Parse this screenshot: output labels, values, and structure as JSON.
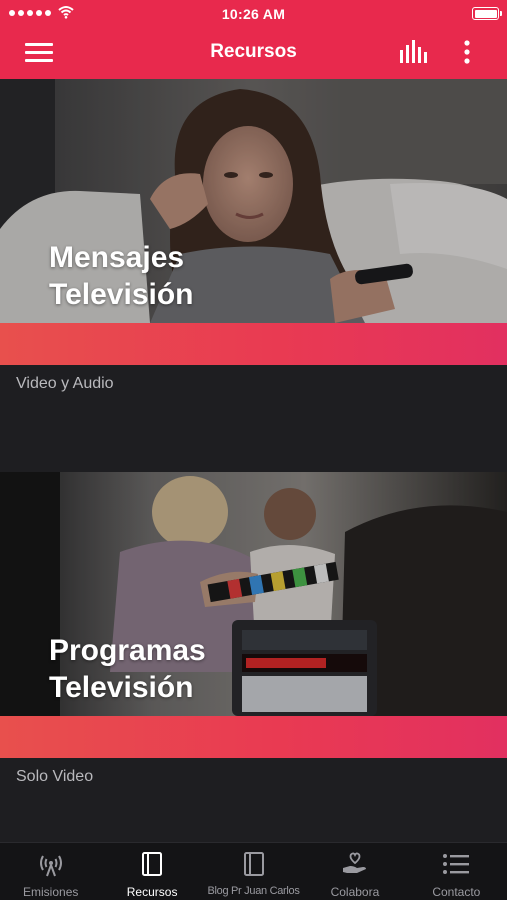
{
  "status_bar": {
    "time": "10:26 AM"
  },
  "header": {
    "title": "Recursos",
    "icons": [
      "hamburger-menu-icon",
      "bar-chart-icon",
      "more-vertical-icon"
    ]
  },
  "cards": [
    {
      "title_line1": "Mensajes",
      "title_line2": "Televisión",
      "subtitle": "Video y Audio"
    },
    {
      "title_line1": "Programas",
      "title_line2": "Televisión",
      "subtitle": "Solo Video"
    }
  ],
  "tabs": [
    {
      "label": "Emisiones",
      "icon": "broadcast-icon",
      "active": false
    },
    {
      "label": "Recursos",
      "icon": "book-icon",
      "active": true
    },
    {
      "label": "Blog Pr Juan Carlos",
      "icon": "book-outline-icon",
      "active": false
    },
    {
      "label": "Colabora",
      "icon": "heart-hand-icon",
      "active": false
    },
    {
      "label": "Contacto",
      "icon": "list-icon",
      "active": false
    }
  ],
  "colors": {
    "brand": "#e8294d",
    "tabbar_bg": "#141416",
    "card_bg": "#1e1e21",
    "subtitle": "#b9b9bd"
  }
}
